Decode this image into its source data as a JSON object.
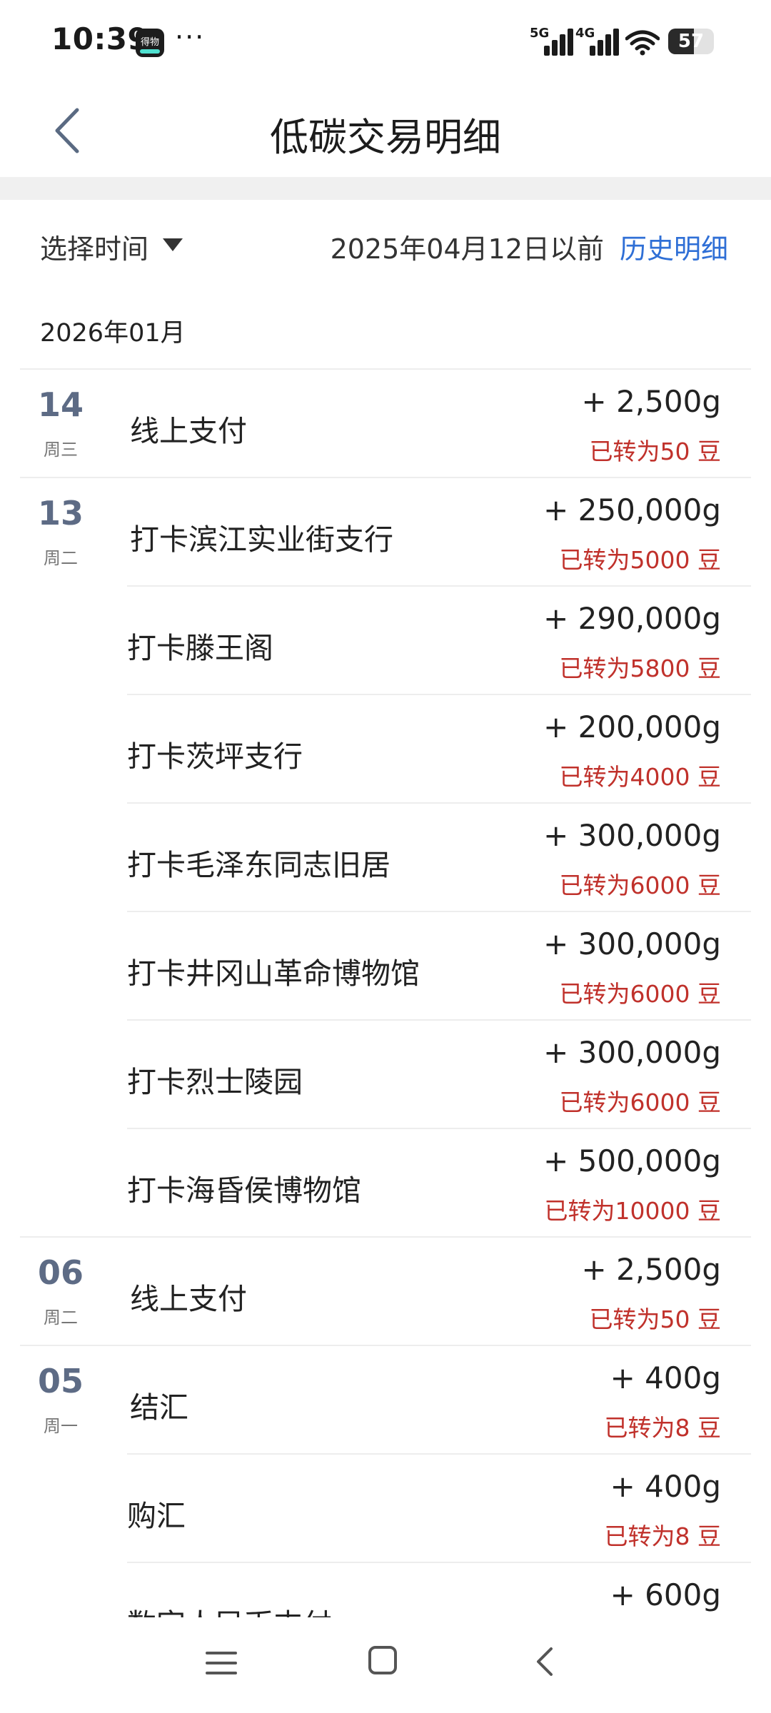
{
  "status_bar": {
    "time": "10:39",
    "app_badge": "得物",
    "more": "···",
    "network_1": "5G",
    "network_2": "4G",
    "battery": "57",
    "battery_level": 0.57
  },
  "header": {
    "title": "低碳交易明细"
  },
  "filter": {
    "select_label": "选择时间",
    "before_date": "2025年04月12日以前",
    "history_link": "历史明细"
  },
  "month": "2026年01月",
  "entries": [
    {
      "day": "14",
      "weekday": "周三",
      "title": "线上支付",
      "amount": "+ 2,500g",
      "beans": "已转为50 豆"
    },
    {
      "day": "13",
      "weekday": "周二",
      "title": "打卡滨江实业街支行",
      "amount": "+ 250,000g",
      "beans": "已转为5000 豆"
    },
    {
      "day": "",
      "weekday": "",
      "title": "打卡滕王阁",
      "amount": "+ 290,000g",
      "beans": "已转为5800 豆"
    },
    {
      "day": "",
      "weekday": "",
      "title": "打卡茨坪支行",
      "amount": "+ 200,000g",
      "beans": "已转为4000 豆"
    },
    {
      "day": "",
      "weekday": "",
      "title": "打卡毛泽东同志旧居",
      "amount": "+ 300,000g",
      "beans": "已转为6000 豆"
    },
    {
      "day": "",
      "weekday": "",
      "title": "打卡井冈山革命博物馆",
      "amount": "+ 300,000g",
      "beans": "已转为6000 豆"
    },
    {
      "day": "",
      "weekday": "",
      "title": "打卡烈士陵园",
      "amount": "+ 300,000g",
      "beans": "已转为6000 豆"
    },
    {
      "day": "",
      "weekday": "",
      "title": "打卡海昏侯博物馆",
      "amount": "+ 500,000g",
      "beans": "已转为10000 豆"
    },
    {
      "day": "06",
      "weekday": "周二",
      "title": "线上支付",
      "amount": "+ 2,500g",
      "beans": "已转为50 豆"
    },
    {
      "day": "05",
      "weekday": "周一",
      "title": "结汇",
      "amount": "+ 400g",
      "beans": "已转为8 豆"
    },
    {
      "day": "",
      "weekday": "",
      "title": "购汇",
      "amount": "+ 400g",
      "beans": "已转为8 豆"
    },
    {
      "day": "",
      "weekday": "",
      "title": "数字人民币支付",
      "amount": "+ 600g",
      "beans": ""
    }
  ],
  "colors": {
    "accent_link": "#2f6fd6",
    "beans_red": "#c0312b",
    "day_slate": "#5d6b85"
  },
  "icons": {
    "back": "chevron-left-icon",
    "dropdown": "caret-down-icon",
    "nav_menu": "menu-icon",
    "nav_home": "home-square-icon",
    "nav_back": "back-chevron-icon"
  }
}
